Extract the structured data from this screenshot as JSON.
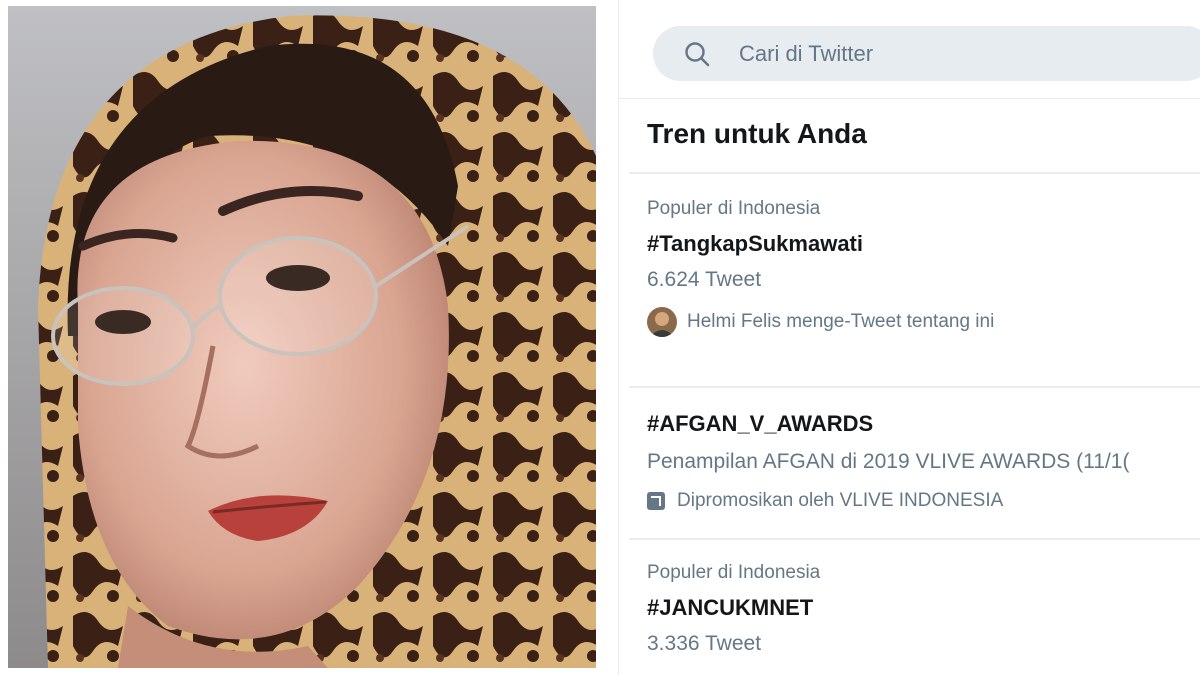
{
  "search": {
    "placeholder": "Cari di Twitter",
    "icon": "search-icon"
  },
  "trends": {
    "title": "Tren untuk Anda",
    "items": [
      {
        "context": "Populer di Indonesia",
        "tag": "#TangkapSukmawati",
        "count": "6.624 Tweet",
        "tweeted_by": "Helmi Felis menge-Tweet tentang ini"
      },
      {
        "tag": "#AFGAN_V_AWARDS",
        "description": "Penampilan AFGAN di 2019 VLIVE AWARDS (11/1(",
        "promoted": "Dipromosikan oleh VLIVE INDONESIA"
      },
      {
        "context": "Populer di Indonesia",
        "tag": "#JANCUKMNET",
        "count": "3.336 Tweet"
      }
    ]
  },
  "colors": {
    "text_primary": "#14171a",
    "text_secondary": "#657786",
    "search_bg": "#e6ecf0",
    "separator": "#e6ecf0"
  }
}
